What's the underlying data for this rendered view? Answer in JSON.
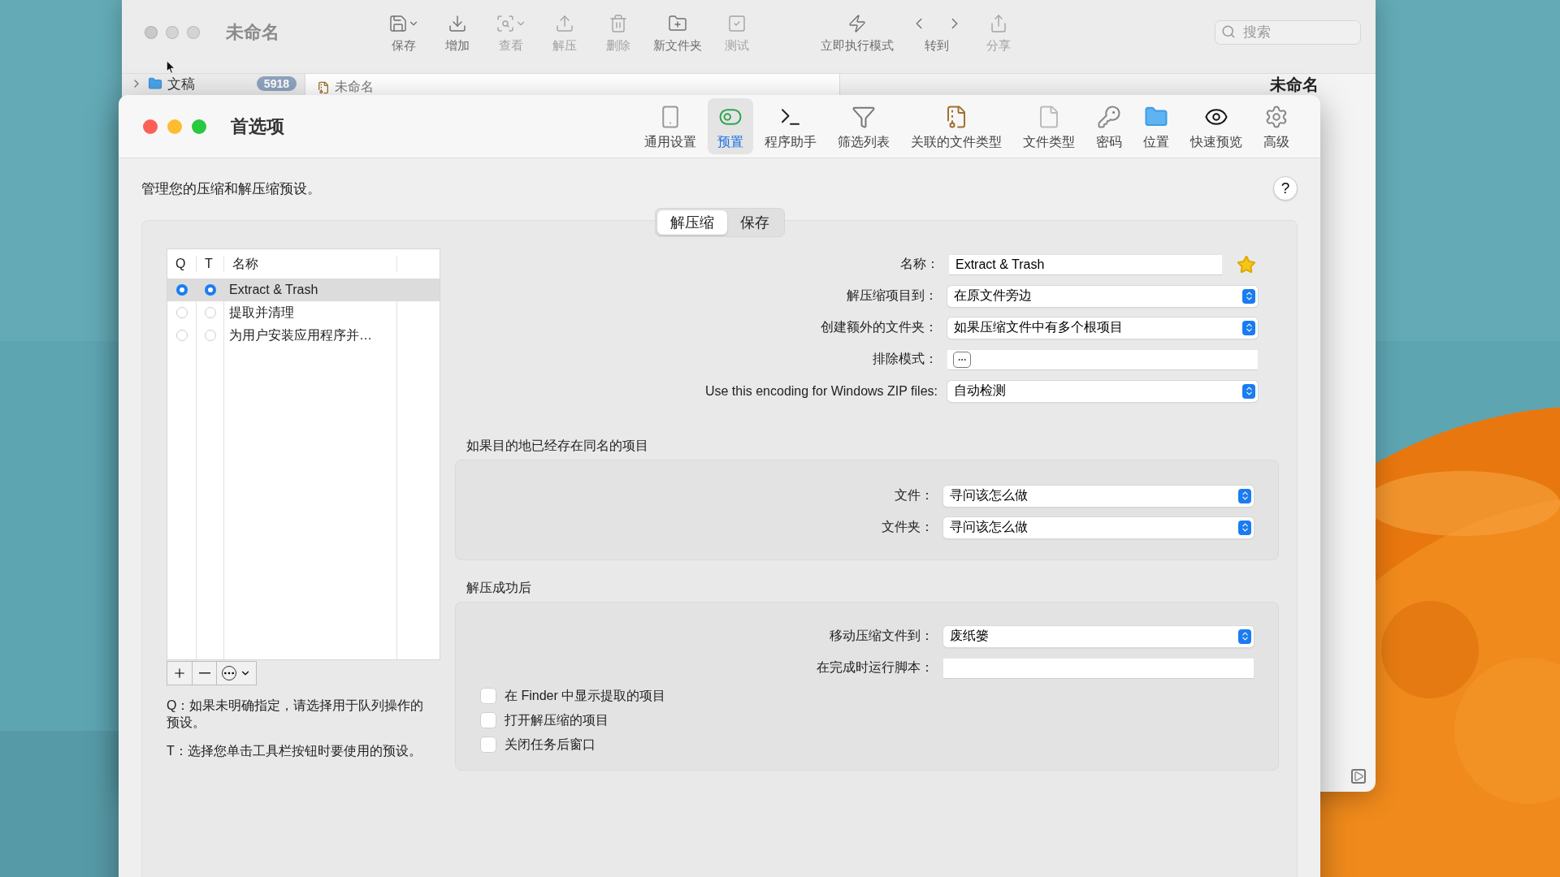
{
  "back_window": {
    "title": "未命名",
    "toolbar": [
      {
        "label": "保存",
        "disabled": false,
        "menu": true
      },
      {
        "label": "增加",
        "disabled": false,
        "menu": false
      },
      {
        "label": "查看",
        "disabled": true,
        "menu": true
      },
      {
        "label": "解压",
        "disabled": true,
        "menu": false
      },
      {
        "label": "删除",
        "disabled": true,
        "menu": false
      },
      {
        "label": "新文件夹",
        "disabled": false,
        "menu": false
      },
      {
        "label": "测试",
        "disabled": true,
        "menu": false
      },
      {
        "label": "立即执行模式",
        "disabled": false,
        "menu": false
      },
      {
        "label": "转到",
        "disabled": false,
        "menu": false
      },
      {
        "label": "分享",
        "disabled": true,
        "menu": false
      }
    ],
    "search": {
      "placeholder": "搜索"
    },
    "sidebar_item": {
      "label": "文稿",
      "badge": "5918",
      "expanded": false
    },
    "tab": {
      "label": "未命名"
    },
    "side_title": "未命名"
  },
  "prefs": {
    "title": "首选项",
    "toolbar": [
      {
        "label": "通用设置",
        "selected": false
      },
      {
        "label": "预置",
        "selected": true
      },
      {
        "label": "程序助手",
        "selected": false
      },
      {
        "label": "筛选列表",
        "selected": false
      },
      {
        "label": "关联的文件类型",
        "selected": false
      },
      {
        "label": "文件类型",
        "selected": false
      },
      {
        "label": "密码",
        "selected": false
      },
      {
        "label": "位置",
        "selected": false
      },
      {
        "label": "快速预览",
        "selected": false
      },
      {
        "label": "高级",
        "selected": false
      }
    ],
    "intro": "管理您的压缩和解压缩预设。",
    "help": "?",
    "segments": [
      {
        "label": "解压缩",
        "selected": true
      },
      {
        "label": "保存",
        "selected": false
      }
    ],
    "preset_list": {
      "columns": [
        "Q",
        "T",
        "名称"
      ],
      "rows": [
        {
          "name": "Extract & Trash",
          "q": true,
          "t": true,
          "selected": true
        },
        {
          "name": "提取并清理",
          "q": false,
          "t": false,
          "selected": false
        },
        {
          "name": "为用户安装应用程序并…",
          "q": false,
          "t": false,
          "selected": false
        }
      ]
    },
    "notes": [
      "Q：如果未明确指定，请选择用于队列操作的预设。",
      "T：选择您单击工具栏按钮时要使用的预设。"
    ],
    "form": [
      {
        "kind": "text",
        "label": "名称：",
        "value": "Extract & Trash",
        "starred": true
      },
      {
        "kind": "select",
        "label": "解压缩项目到：",
        "value": "在原文件旁边"
      },
      {
        "kind": "select",
        "label": "创建额外的文件夹：",
        "value": "如果压缩文件中有多个根项目"
      },
      {
        "kind": "pattern",
        "label": "排除模式："
      },
      {
        "kind": "select",
        "label": "Use this encoding for Windows ZIP files:",
        "value": "自动检测"
      }
    ],
    "groups": [
      {
        "title": "如果目的地已经存在同名的项目",
        "fields": [
          {
            "kind": "select",
            "label": "文件：",
            "value": "寻问该怎么做"
          },
          {
            "kind": "select",
            "label": "文件夹：",
            "value": "寻问该怎么做"
          }
        ]
      },
      {
        "title": "解压成功后",
        "fields": [
          {
            "kind": "select",
            "label": "移动压缩文件到：",
            "value": "废纸篓"
          },
          {
            "kind": "text",
            "label": "在完成时运行脚本："
          }
        ],
        "checkboxes": [
          {
            "label": "在 Finder 中显示提取的项目",
            "checked": false
          },
          {
            "label": "打开解压缩的项目",
            "checked": false
          },
          {
            "label": "关闭任务后窗口",
            "checked": false
          }
        ]
      }
    ]
  }
}
